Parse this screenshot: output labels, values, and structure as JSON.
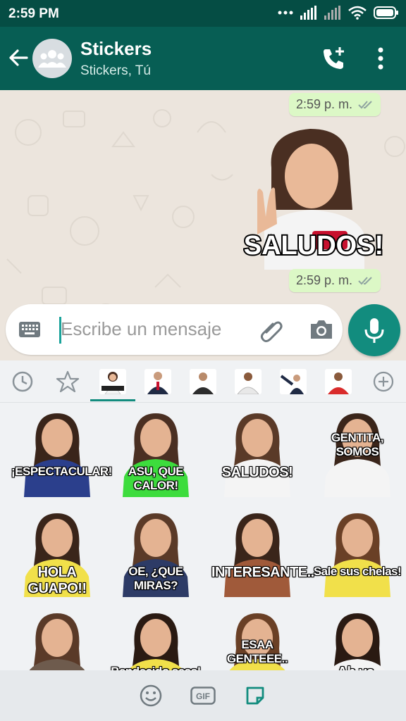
{
  "status_bar": {
    "time": "2:59 PM"
  },
  "header": {
    "title": "Stickers",
    "subtitle": "Stickers, Tú"
  },
  "messages": [
    {
      "time": "2:59 p. m."
    },
    {
      "sticker_caption": "SALUDOS!",
      "time": "2:59 p. m."
    }
  ],
  "composer": {
    "placeholder": "Escribe un mensaje"
  },
  "sticker_grid": [
    {
      "caption": "¡ESPECTACULAR!",
      "shirt": "#2b3f8c"
    },
    {
      "caption": "ASU, QUE CALOR!",
      "shirt": "#3ddc3d"
    },
    {
      "caption": "SALUDOS!",
      "shirt": "#f4f4f4"
    },
    {
      "caption": "GENTITA, SOMOS",
      "shirt": "#f4f4f4"
    },
    {
      "caption": "HOLA GUAPO!!",
      "shirt": "#f1e04a"
    },
    {
      "caption": "OE, ¿QUE MIRAS?",
      "shirt": "#2d3b66"
    },
    {
      "caption": "INTERESANTE..",
      "shirt": "#a05a3a"
    },
    {
      "caption": "Sale sus chelas!",
      "shirt": "#f1e04a"
    },
    {
      "caption": "",
      "shirt": "#6e5b4d"
    },
    {
      "caption": "Bendecido seas!",
      "shirt": "#f1e04a"
    },
    {
      "caption": "ESAA GENTEEE..",
      "shirt": "#f1e04a"
    },
    {
      "caption": "Ah ya,",
      "shirt": "#f4f4f4"
    }
  ],
  "colors": {
    "header": "#075e54",
    "status": "#054d44",
    "accent": "#128c7e",
    "bubble": "#dcf8c6"
  },
  "bottom_bar": {
    "gif_label": "GIF"
  }
}
